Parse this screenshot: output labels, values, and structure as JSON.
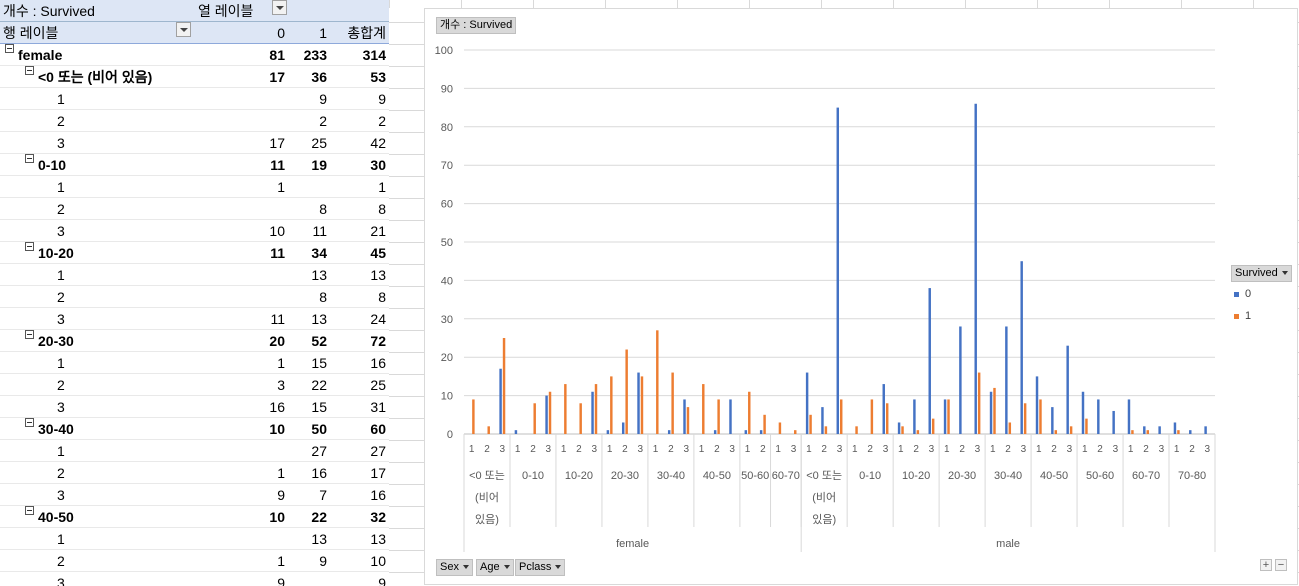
{
  "pivot": {
    "count_label": "개수 : Survived",
    "col_labels": "열 레이블",
    "row_labels": "행 레이블",
    "col_head_0": "0",
    "col_head_1": "1",
    "col_head_total": "총합계",
    "rows": [
      {
        "label": "female",
        "level": 0,
        "v0": "81",
        "v1": "233",
        "t": "314",
        "toggle": true
      },
      {
        "label": "<0 또는 (비어 있음)",
        "level": 1,
        "v0": "17",
        "v1": "36",
        "t": "53",
        "toggle": true
      },
      {
        "label": "1",
        "level": 2,
        "v0": "",
        "v1": "9",
        "t": "9"
      },
      {
        "label": "2",
        "level": 2,
        "v0": "",
        "v1": "2",
        "t": "2"
      },
      {
        "label": "3",
        "level": 2,
        "v0": "17",
        "v1": "25",
        "t": "42"
      },
      {
        "label": "0-10",
        "level": 1,
        "v0": "11",
        "v1": "19",
        "t": "30",
        "toggle": true
      },
      {
        "label": "1",
        "level": 2,
        "v0": "1",
        "v1": "",
        "t": "1"
      },
      {
        "label": "2",
        "level": 2,
        "v0": "",
        "v1": "8",
        "t": "8"
      },
      {
        "label": "3",
        "level": 2,
        "v0": "10",
        "v1": "11",
        "t": "21"
      },
      {
        "label": "10-20",
        "level": 1,
        "v0": "11",
        "v1": "34",
        "t": "45",
        "toggle": true
      },
      {
        "label": "1",
        "level": 2,
        "v0": "",
        "v1": "13",
        "t": "13"
      },
      {
        "label": "2",
        "level": 2,
        "v0": "",
        "v1": "8",
        "t": "8"
      },
      {
        "label": "3",
        "level": 2,
        "v0": "11",
        "v1": "13",
        "t": "24"
      },
      {
        "label": "20-30",
        "level": 1,
        "v0": "20",
        "v1": "52",
        "t": "72",
        "toggle": true
      },
      {
        "label": "1",
        "level": 2,
        "v0": "1",
        "v1": "15",
        "t": "16"
      },
      {
        "label": "2",
        "level": 2,
        "v0": "3",
        "v1": "22",
        "t": "25"
      },
      {
        "label": "3",
        "level": 2,
        "v0": "16",
        "v1": "15",
        "t": "31"
      },
      {
        "label": "30-40",
        "level": 1,
        "v0": "10",
        "v1": "50",
        "t": "60",
        "toggle": true
      },
      {
        "label": "1",
        "level": 2,
        "v0": "",
        "v1": "27",
        "t": "27"
      },
      {
        "label": "2",
        "level": 2,
        "v0": "1",
        "v1": "16",
        "t": "17"
      },
      {
        "label": "3",
        "level": 2,
        "v0": "9",
        "v1": "7",
        "t": "16"
      },
      {
        "label": "40-50",
        "level": 1,
        "v0": "10",
        "v1": "22",
        "t": "32",
        "toggle": true
      },
      {
        "label": "1",
        "level": 2,
        "v0": "",
        "v1": "13",
        "t": "13"
      },
      {
        "label": "2",
        "level": 2,
        "v0": "1",
        "v1": "9",
        "t": "10"
      },
      {
        "label": "3",
        "level": 2,
        "v0": "9",
        "v1": "",
        "t": "9"
      }
    ]
  },
  "chart_data": {
    "type": "bar",
    "title_button": "개수 : Survived",
    "ylim": [
      0,
      100
    ],
    "yticks": [
      0,
      10,
      20,
      30,
      40,
      50,
      60,
      70,
      80,
      90,
      100
    ],
    "grid": true,
    "legend_title": "Survived",
    "legend_position": "right",
    "series": [
      {
        "name": "0",
        "color": "#4472c4"
      },
      {
        "name": "1",
        "color": "#ed7d31"
      }
    ],
    "sex_groups": [
      {
        "sex": "female",
        "age_groups": [
          {
            "age": "<0 또는 (비어 있음)",
            "pclass": [
              [
                "1",
                null,
                9
              ],
              [
                "2",
                null,
                2
              ],
              [
                "3",
                17,
                25
              ]
            ]
          },
          {
            "age": "0-10",
            "pclass": [
              [
                "1",
                1,
                null
              ],
              [
                "2",
                null,
                8
              ],
              [
                "3",
                10,
                11
              ]
            ]
          },
          {
            "age": "10-20",
            "pclass": [
              [
                "1",
                null,
                13
              ],
              [
                "2",
                null,
                8
              ],
              [
                "3",
                11,
                13
              ]
            ]
          },
          {
            "age": "20-30",
            "pclass": [
              [
                "1",
                1,
                15
              ],
              [
                "2",
                3,
                22
              ],
              [
                "3",
                16,
                15
              ]
            ]
          },
          {
            "age": "30-40",
            "pclass": [
              [
                "1",
                null,
                27
              ],
              [
                "2",
                1,
                16
              ],
              [
                "3",
                9,
                7
              ]
            ]
          },
          {
            "age": "40-50",
            "pclass": [
              [
                "1",
                null,
                13
              ],
              [
                "2",
                1,
                9
              ],
              [
                "3",
                9,
                null
              ]
            ]
          },
          {
            "age": "50-60",
            "pclass": [
              [
                "1",
                1,
                11
              ],
              [
                "2",
                1,
                5
              ]
            ]
          },
          {
            "age": "60-70",
            "pclass": [
              [
                "1",
                null,
                3
              ],
              [
                "3",
                null,
                1
              ]
            ]
          }
        ]
      },
      {
        "sex": "male",
        "age_groups": [
          {
            "age": "<0 또는 (비어 있음)",
            "pclass": [
              [
                "1",
                16,
                5
              ],
              [
                "2",
                7,
                2
              ],
              [
                "3",
                85,
                9
              ]
            ]
          },
          {
            "age": "0-10",
            "pclass": [
              [
                "1",
                null,
                2
              ],
              [
                "2",
                null,
                9
              ],
              [
                "3",
                13,
                8
              ]
            ]
          },
          {
            "age": "10-20",
            "pclass": [
              [
                "1",
                3,
                2
              ],
              [
                "2",
                9,
                1
              ],
              [
                "3",
                38,
                4
              ]
            ]
          },
          {
            "age": "20-30",
            "pclass": [
              [
                "1",
                9,
                9
              ],
              [
                "2",
                28,
                null
              ],
              [
                "3",
                86,
                16
              ]
            ]
          },
          {
            "age": "30-40",
            "pclass": [
              [
                "1",
                11,
                12
              ],
              [
                "2",
                28,
                3
              ],
              [
                "3",
                45,
                8
              ]
            ]
          },
          {
            "age": "40-50",
            "pclass": [
              [
                "1",
                15,
                9
              ],
              [
                "2",
                7,
                1
              ],
              [
                "3",
                23,
                2
              ]
            ]
          },
          {
            "age": "50-60",
            "pclass": [
              [
                "1",
                11,
                4
              ],
              [
                "2",
                9,
                null
              ],
              [
                "3",
                6,
                null
              ]
            ]
          },
          {
            "age": "60-70",
            "pclass": [
              [
                "1",
                9,
                1
              ],
              [
                "2",
                2,
                1
              ],
              [
                "3",
                2,
                null
              ]
            ]
          },
          {
            "age": "70-80",
            "pclass": [
              [
                "1",
                3,
                1
              ],
              [
                "2",
                1,
                null
              ],
              [
                "3",
                2,
                null
              ]
            ]
          }
        ]
      }
    ]
  },
  "field_buttons": {
    "sex": "Sex",
    "age": "Age",
    "pclass": "Pclass"
  },
  "zoom": {
    "plus": "+",
    "minus": "−"
  }
}
